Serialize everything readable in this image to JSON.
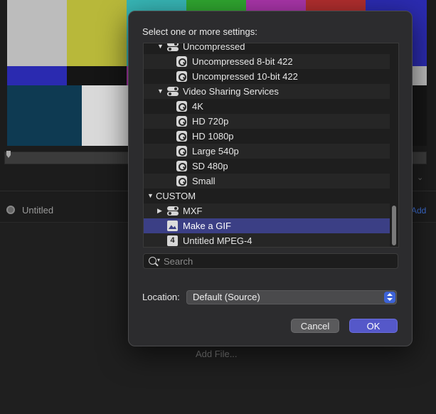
{
  "background": {
    "panel_title": "Untitled",
    "add_link": "Add",
    "add_file": "Add File..."
  },
  "dialog": {
    "prompt": "Select one or more settings:",
    "tree": {
      "uncompressed": "Uncompressed",
      "unc_8bit": "Uncompressed 8-bit 422",
      "unc_10bit": "Uncompressed 10-bit 422",
      "video_sharing": "Video Sharing Services",
      "vs_4k": "4K",
      "vs_720": "HD 720p",
      "vs_1080": "HD 1080p",
      "vs_540": "Large 540p",
      "vs_480": "SD 480p",
      "vs_small": "Small",
      "custom": "CUSTOM",
      "mxf": "MXF",
      "gif": "Make a GIF",
      "mpeg4": "Untitled MPEG-4",
      "mpeg4_badge": "4",
      "selected": "Make a GIF"
    },
    "search_placeholder": "Search",
    "location_label": "Location:",
    "location_value": "Default (Source)",
    "cancel_label": "Cancel",
    "ok_label": "OK"
  },
  "colors": {
    "selection": "#3b3f85",
    "accent": "#5558c9",
    "dialog_bg": "#2c2c2e"
  }
}
